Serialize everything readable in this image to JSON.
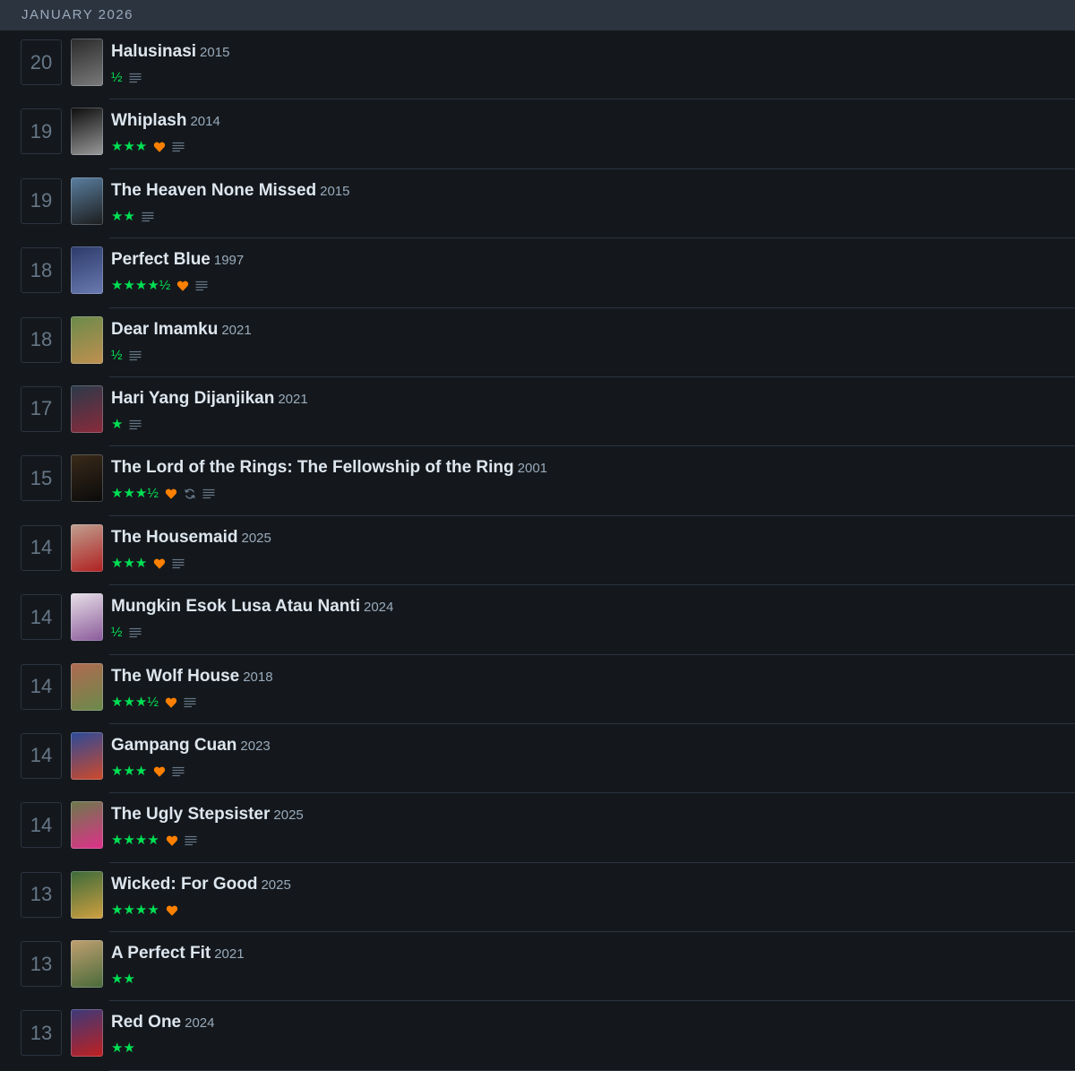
{
  "header": {
    "month": "JANUARY 2026"
  },
  "entries": [
    {
      "day": "20",
      "title": "Halusinasi",
      "year": "2015",
      "rating": "½",
      "liked": false,
      "rewatch": false,
      "review": true,
      "poster_colors": [
        "#2a2a2a",
        "#7a7a7a"
      ]
    },
    {
      "day": "19",
      "title": "Whiplash",
      "year": "2014",
      "rating": "★★★",
      "liked": true,
      "rewatch": false,
      "review": true,
      "poster_colors": [
        "#0c0c0c",
        "#9a9a9a"
      ]
    },
    {
      "day": "19",
      "title": "The Heaven None Missed",
      "year": "2015",
      "rating": "★★",
      "liked": false,
      "rewatch": false,
      "review": true,
      "poster_colors": [
        "#5a7fa0",
        "#1c1c1c"
      ]
    },
    {
      "day": "18",
      "title": "Perfect Blue",
      "year": "1997",
      "rating": "★★★★½",
      "liked": true,
      "rewatch": false,
      "review": true,
      "poster_colors": [
        "#2c3a6a",
        "#6a7ab0"
      ]
    },
    {
      "day": "18",
      "title": "Dear Imamku",
      "year": "2021",
      "rating": "½",
      "liked": false,
      "rewatch": false,
      "review": true,
      "poster_colors": [
        "#6a8a4a",
        "#c09050"
      ]
    },
    {
      "day": "17",
      "title": "Hari Yang Dijanjikan",
      "year": "2021",
      "rating": "★",
      "liked": false,
      "rewatch": false,
      "review": true,
      "poster_colors": [
        "#2a3a4a",
        "#8a2a3a"
      ]
    },
    {
      "day": "15",
      "title": "The Lord of the Rings: The Fellowship of the Ring",
      "year": "2001",
      "rating": "★★★½",
      "liked": true,
      "rewatch": true,
      "review": true,
      "poster_colors": [
        "#3a2a1a",
        "#0a0a0a"
      ]
    },
    {
      "day": "14",
      "title": "The Housemaid",
      "year": "2025",
      "rating": "★★★",
      "liked": true,
      "rewatch": false,
      "review": true,
      "poster_colors": [
        "#c0a090",
        "#b02020"
      ]
    },
    {
      "day": "14",
      "title": "Mungkin Esok Lusa Atau Nanti",
      "year": "2024",
      "rating": "½",
      "liked": false,
      "rewatch": false,
      "review": true,
      "poster_colors": [
        "#e8e0e8",
        "#8a5a9a"
      ]
    },
    {
      "day": "14",
      "title": "The Wolf House",
      "year": "2018",
      "rating": "★★★½",
      "liked": true,
      "rewatch": false,
      "review": true,
      "poster_colors": [
        "#b06a50",
        "#6a8a4a"
      ]
    },
    {
      "day": "14",
      "title": "Gampang Cuan",
      "year": "2023",
      "rating": "★★★",
      "liked": true,
      "rewatch": false,
      "review": true,
      "poster_colors": [
        "#2a4a9a",
        "#d04a2a"
      ]
    },
    {
      "day": "14",
      "title": "The Ugly Stepsister",
      "year": "2025",
      "rating": "★★★★",
      "liked": true,
      "rewatch": false,
      "review": true,
      "poster_colors": [
        "#6a7a4a",
        "#e0308a"
      ]
    },
    {
      "day": "13",
      "title": "Wicked: For Good",
      "year": "2025",
      "rating": "★★★★",
      "liked": true,
      "rewatch": false,
      "review": false,
      "poster_colors": [
        "#3a6a3a",
        "#d0a040"
      ]
    },
    {
      "day": "13",
      "title": "A Perfect Fit",
      "year": "2021",
      "rating": "★★",
      "liked": false,
      "rewatch": false,
      "review": false,
      "poster_colors": [
        "#c0a070",
        "#4a6a3a"
      ]
    },
    {
      "day": "13",
      "title": "Red One",
      "year": "2024",
      "rating": "★★",
      "liked": false,
      "rewatch": false,
      "review": false,
      "poster_colors": [
        "#3a3a7a",
        "#c02020"
      ]
    }
  ],
  "icons": {
    "heart": "heart-icon",
    "rewatch": "rewatch-icon",
    "review": "review-icon"
  },
  "colors": {
    "stars": "#00e054",
    "heart": "#ff8000",
    "muted_icon": "#678"
  }
}
